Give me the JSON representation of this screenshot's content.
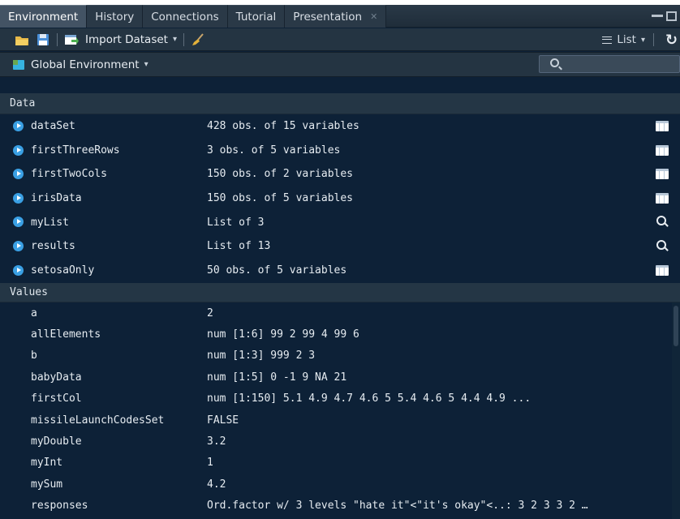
{
  "tabs": [
    {
      "label": "Environment",
      "active": true
    },
    {
      "label": "History",
      "active": false
    },
    {
      "label": "Connections",
      "active": false
    },
    {
      "label": "Tutorial",
      "active": false
    },
    {
      "label": "Presentation",
      "active": false,
      "closable": true
    }
  ],
  "toolbar": {
    "import_dataset": "Import Dataset",
    "view_mode": "List"
  },
  "environment": {
    "selector": "Global Environment",
    "search_placeholder": ""
  },
  "data_section": {
    "header": "Data",
    "rows": [
      {
        "name": "dataSet",
        "value": "428 obs. of 15 variables",
        "action": "table"
      },
      {
        "name": "firstThreeRows",
        "value": "3 obs. of 5 variables",
        "action": "table"
      },
      {
        "name": "firstTwoCols",
        "value": "150 obs. of 2 variables",
        "action": "table"
      },
      {
        "name": "irisData",
        "value": "150 obs. of 5 variables",
        "action": "table"
      },
      {
        "name": "myList",
        "value": "List of 3",
        "action": "search"
      },
      {
        "name": "results",
        "value": "List of 13",
        "action": "search"
      },
      {
        "name": "setosaOnly",
        "value": "50 obs. of 5 variables",
        "action": "table"
      }
    ]
  },
  "values_section": {
    "header": "Values",
    "rows": [
      {
        "name": "a",
        "value": "2"
      },
      {
        "name": "allElements",
        "value": "num [1:6] 99 2 99 4 99 6"
      },
      {
        "name": "b",
        "value": "num [1:3] 999 2 3"
      },
      {
        "name": "babyData",
        "value": "num [1:5] 0 -1 9 NA 21"
      },
      {
        "name": "firstCol",
        "value": "num [1:150] 5.1 4.9 4.7 4.6 5 5.4 4.6 5 4.4 4.9 ..."
      },
      {
        "name": "missileLaunchCodesSet",
        "value": "FALSE"
      },
      {
        "name": "myDouble",
        "value": "3.2"
      },
      {
        "name": "myInt",
        "value": "1"
      },
      {
        "name": "mySum",
        "value": "4.2"
      },
      {
        "name": "responses",
        "value": "Ord.factor w/ 3 levels \"hate it\"<\"it's okay\"<..: 3 2 3 3 2 …"
      }
    ]
  }
}
